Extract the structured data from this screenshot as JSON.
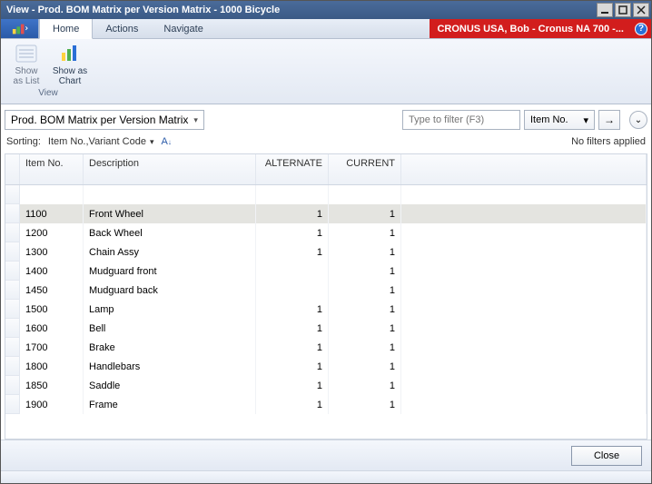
{
  "window": {
    "title": "View - Prod. BOM Matrix per Version Matrix - 1000 Bicycle"
  },
  "menubar": {
    "tabs": {
      "home": "Home",
      "actions": "Actions",
      "navigate": "Navigate"
    },
    "company": "CRONUS USA, Bob - Cronus NA 700 -..."
  },
  "ribbon": {
    "show_list": "Show\nas List",
    "show_chart": "Show as\nChart",
    "group": "View"
  },
  "toolbar": {
    "view_name": "Prod. BOM Matrix per Version Matrix",
    "filter_placeholder": "Type to filter (F3)",
    "filter_field": "Item No.",
    "sorting_label": "Sorting:",
    "sorting_value": "Item No.,Variant Code",
    "no_filters": "No filters applied"
  },
  "grid": {
    "headers": {
      "item": "Item No.",
      "desc": "Description",
      "alt": "ALTERNATE",
      "cur": "CURRENT"
    },
    "rows": [
      {
        "item": "1100",
        "desc": "Front Wheel",
        "alt": "1",
        "cur": "1",
        "selected": true
      },
      {
        "item": "1200",
        "desc": "Back Wheel",
        "alt": "1",
        "cur": "1"
      },
      {
        "item": "1300",
        "desc": "Chain Assy",
        "alt": "1",
        "cur": "1"
      },
      {
        "item": "1400",
        "desc": "Mudguard front",
        "alt": "",
        "cur": "1"
      },
      {
        "item": "1450",
        "desc": "Mudguard back",
        "alt": "",
        "cur": "1"
      },
      {
        "item": "1500",
        "desc": "Lamp",
        "alt": "1",
        "cur": "1"
      },
      {
        "item": "1600",
        "desc": "Bell",
        "alt": "1",
        "cur": "1"
      },
      {
        "item": "1700",
        "desc": "Brake",
        "alt": "1",
        "cur": "1"
      },
      {
        "item": "1800",
        "desc": "Handlebars",
        "alt": "1",
        "cur": "1"
      },
      {
        "item": "1850",
        "desc": "Saddle",
        "alt": "1",
        "cur": "1"
      },
      {
        "item": "1900",
        "desc": "Frame",
        "alt": "1",
        "cur": "1"
      }
    ]
  },
  "footer": {
    "close": "Close"
  }
}
